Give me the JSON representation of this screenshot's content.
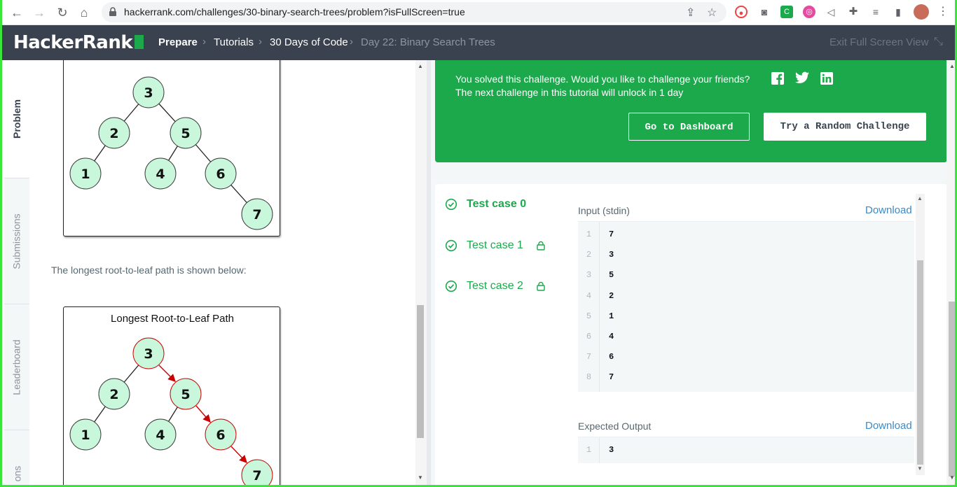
{
  "browser": {
    "url": "hackerrank.com/challenges/30-binary-search-trees/problem?isFullScreen=true"
  },
  "header": {
    "logo_text": "HackerRank",
    "breadcrumbs": [
      "Prepare",
      "Tutorials",
      "30 Days of Code",
      "Day 22: Binary Search Trees"
    ],
    "exit_fullscreen": "Exit Full Screen View"
  },
  "side_tabs": [
    "Problem",
    "Submissions",
    "Leaderboard",
    "ons"
  ],
  "problem": {
    "tree1_title": "",
    "tree1_nodes": [
      "3",
      "2",
      "5",
      "1",
      "4",
      "6",
      "7"
    ],
    "path_text": "The longest root-to-leaf path is shown below:",
    "tree2_title": "Longest Root-to-Leaf Path",
    "tree2_nodes": [
      "3",
      "2",
      "5",
      "1",
      "4",
      "6",
      "7"
    ]
  },
  "banner": {
    "line1": "You solved this challenge. Would you like to challenge your friends?",
    "line2": "The next challenge in this tutorial will unlock in 1 day",
    "dashboard_button": "Go to Dashboard",
    "random_button": "Try a Random Challenge"
  },
  "tests": {
    "cases": [
      {
        "label": "Test case 0",
        "locked": false
      },
      {
        "label": "Test case 1",
        "locked": true
      },
      {
        "label": "Test case 2",
        "locked": true
      }
    ],
    "input_title": "Input (stdin)",
    "output_title": "Expected Output",
    "download_label": "Download",
    "input_lines": [
      "7",
      "3",
      "5",
      "2",
      "1",
      "4",
      "6",
      "7"
    ],
    "output_lines": [
      "3"
    ]
  },
  "colors": {
    "brand_green": "#1ba94c",
    "header_bg": "#39424e",
    "node_fill": "#c8f7dc",
    "path_red": "#cc0000"
  }
}
